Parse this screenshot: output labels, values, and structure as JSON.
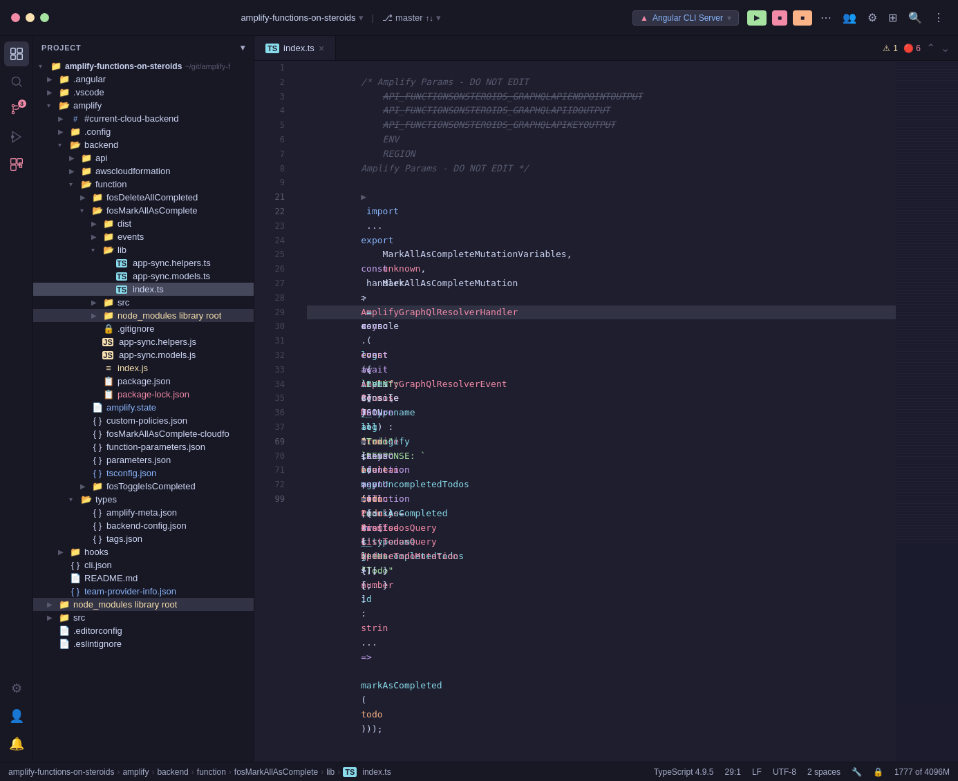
{
  "titlebar": {
    "project": "amplify-functions-on-steroids",
    "branch": "master",
    "server": "Angular CLI Server",
    "icons": [
      "ellipsis",
      "people",
      "wrench",
      "gamepad",
      "search",
      "more"
    ]
  },
  "sidebar": {
    "header": "Project",
    "tree": [
      {
        "label": "amplify-functions-on-steroids",
        "type": "root",
        "depth": 0,
        "open": true,
        "suffix": "~/git/amplify-f"
      },
      {
        "label": ".angular",
        "type": "folder-closed",
        "depth": 1,
        "color": "blue"
      },
      {
        "label": ".vscode",
        "type": "folder-closed",
        "depth": 1,
        "color": "blue"
      },
      {
        "label": "amplify",
        "type": "folder-open",
        "depth": 1,
        "color": "blue"
      },
      {
        "label": "#current-cloud-backend",
        "type": "folder-closed",
        "depth": 2,
        "color": "blue"
      },
      {
        "label": ".config",
        "type": "folder-closed",
        "depth": 2,
        "color": "blue"
      },
      {
        "label": "backend",
        "type": "folder-open",
        "depth": 2,
        "color": "blue"
      },
      {
        "label": "api",
        "type": "folder-closed",
        "depth": 3,
        "color": "blue"
      },
      {
        "label": "awscloudformation",
        "type": "folder-closed",
        "depth": 3,
        "color": "blue"
      },
      {
        "label": "function",
        "type": "folder-open",
        "depth": 3,
        "color": "blue"
      },
      {
        "label": "fosDeleteAllCompleted",
        "type": "folder-closed",
        "depth": 4,
        "color": "blue"
      },
      {
        "label": "fosMarkAllAsComplete",
        "type": "folder-open",
        "depth": 4,
        "color": "blue"
      },
      {
        "label": "dist",
        "type": "folder-closed",
        "depth": 5,
        "color": "blue"
      },
      {
        "label": "events",
        "type": "folder-closed",
        "depth": 5,
        "color": "blue"
      },
      {
        "label": "lib",
        "type": "folder-open",
        "depth": 5,
        "color": "blue"
      },
      {
        "label": "app-sync.helpers.ts",
        "type": "file-ts",
        "depth": 6
      },
      {
        "label": "app-sync.models.ts",
        "type": "file-ts",
        "depth": 6
      },
      {
        "label": "index.ts",
        "type": "file-ts",
        "depth": 6,
        "selected": true
      },
      {
        "label": "src",
        "type": "folder-closed",
        "depth": 5,
        "color": "blue"
      },
      {
        "label": "node_modules  library root",
        "type": "folder-closed",
        "depth": 5,
        "color": "yellow"
      },
      {
        "label": ".gitignore",
        "type": "file-git",
        "depth": 5
      },
      {
        "label": "app-sync.helpers.js",
        "type": "file-js",
        "depth": 5
      },
      {
        "label": "app-sync.models.js",
        "type": "file-js",
        "depth": 5
      },
      {
        "label": "index.js",
        "type": "file-js",
        "depth": 5
      },
      {
        "label": "package.json",
        "type": "file-json",
        "depth": 5
      },
      {
        "label": "package-lock.json",
        "type": "file-json-red",
        "depth": 5
      },
      {
        "label": "amplify.state",
        "type": "file-state",
        "depth": 4
      },
      {
        "label": "custom-policies.json",
        "type": "file-json",
        "depth": 4
      },
      {
        "label": "fosMarkAllAsComplete-cloudfo",
        "type": "file-json",
        "depth": 4
      },
      {
        "label": "function-parameters.json",
        "type": "file-json",
        "depth": 4
      },
      {
        "label": "parameters.json",
        "type": "file-json",
        "depth": 4
      },
      {
        "label": "tsconfig.json",
        "type": "file-json-blue",
        "depth": 4
      },
      {
        "label": "fosToggleIsCompleted",
        "type": "folder-closed",
        "depth": 4,
        "color": "blue"
      },
      {
        "label": "types",
        "type": "folder-open",
        "depth": 3,
        "color": "blue"
      },
      {
        "label": "amplify-meta.json",
        "type": "file-json",
        "depth": 4
      },
      {
        "label": "backend-config.json",
        "type": "file-json",
        "depth": 4
      },
      {
        "label": "tags.json",
        "type": "file-json",
        "depth": 4
      },
      {
        "label": "hooks",
        "type": "folder-closed",
        "depth": 2,
        "color": "blue"
      },
      {
        "label": "cli.json",
        "type": "file-json",
        "depth": 2
      },
      {
        "label": "README.md",
        "type": "file-md",
        "depth": 2
      },
      {
        "label": "team-provider-info.json",
        "type": "file-json-blue",
        "depth": 2
      },
      {
        "label": "node_modules  library root",
        "type": "folder-closed",
        "depth": 1,
        "color": "yellow"
      },
      {
        "label": "src",
        "type": "folder-closed",
        "depth": 1,
        "color": "blue"
      },
      {
        "label": ".editorconfig",
        "type": "file-plain",
        "depth": 1
      },
      {
        "label": ".eslintignore",
        "type": "file-plain",
        "depth": 1
      }
    ]
  },
  "editor": {
    "tab": "index.ts",
    "warnings": "1",
    "errors": "6",
    "lines": [
      {
        "num": 1,
        "content": "/* Amplify Params - DO NOT EDIT",
        "type": "comment"
      },
      {
        "num": 2,
        "content": "\tAPI_FUNCTIONSONSTEROIDS_GRAPHQLAPIENDPOINTOUTPUT",
        "type": "comment-strikethrough"
      },
      {
        "num": 3,
        "content": "\tAPI_FUNCTIONSONSTEROIDS_GRAPHQLAPIIDOUTPUT",
        "type": "comment-strikethrough"
      },
      {
        "num": 4,
        "content": "\tAPI_FUNCTIONSONSTEROIDS_GRAPHQLAPIKEYOUTPUT",
        "type": "comment-strikethrough"
      },
      {
        "num": 5,
        "content": "\tENV",
        "type": "comment"
      },
      {
        "num": 6,
        "content": "\tREGION",
        "type": "comment"
      },
      {
        "num": 7,
        "content": "Amplify Params - DO NOT EDIT */",
        "type": "comment"
      },
      {
        "num": 8,
        "content": "",
        "type": "empty"
      },
      {
        "num": 9,
        "content": "> import ...",
        "type": "fold"
      },
      {
        "num": 21,
        "content": "",
        "type": "empty"
      },
      {
        "num": 22,
        "content": "",
        "type": "empty"
      },
      {
        "num": 23,
        "content": "export const handler: AmplifyGraphQlResolverHandler<",
        "type": "code"
      },
      {
        "num": 24,
        "content": "\tMarkAllAsCompleteMutationVariables,",
        "type": "code"
      },
      {
        "num": 25,
        "content": "\tunknown,",
        "type": "code"
      },
      {
        "num": 26,
        "content": "\tMarkAllAsCompleteMutation",
        "type": "code"
      },
      {
        "num": 27,
        "content": "> = async (event : AmplifyGraphQlResolverEvent<Ma... > ) : Promise<boolean>  => {",
        "type": "code"
      },
      {
        "num": 28,
        "content": "\tconsole.log(`EVENT: ${JSON.stringify(event, null, 2)}`);",
        "type": "code"
      },
      {
        "num": 29,
        "content": "",
        "type": "empty"
      },
      {
        "num": 30,
        "content": "\tconst { items } : {__typename: \"Todo\", id: strin...  } = await getUncompletedTodos();",
        "type": "code"
      },
      {
        "num": 31,
        "content": "\tawait Promise.all(items.map(todo : {__typename: \"Todo\", id: strin...  => markAsCompleted(todo)));",
        "type": "code"
      },
      {
        "num": 32,
        "content": "",
        "type": "empty"
      },
      {
        "num": 33,
        "content": "\tconsole.log(`RESPONSE: `);",
        "type": "code"
      },
      {
        "num": 34,
        "content": "\treturn true;",
        "type": "code"
      },
      {
        "num": 35,
        "content": "}",
        "type": "code"
      },
      {
        "num": 36,
        "content": "",
        "type": "empty"
      },
      {
        "num": 37,
        "content": "> async function getUncompletedTodos(): Promise<ListTodosQuery> {...}",
        "type": "fold"
      },
      {
        "num": 69,
        "content": "",
        "type": "empty"
      },
      {
        "num": 70,
        "content": "\tasync function markAsCompleted(",
        "type": "code"
      },
      {
        "num": 71,
        "content": "\t\ttodo: ListTodosQuery['items'][number]",
        "type": "code"
      },
      {
        "num": 72,
        "content": "> ): Promise<UpdateTodoMutation> {...}",
        "type": "fold"
      },
      {
        "num": 99,
        "content": "",
        "type": "empty"
      }
    ]
  },
  "statusbar": {
    "breadcrumbs": [
      "amplify-functions-on-steroids",
      "amplify",
      "backend",
      "function",
      "fosMarkAllAsComplete",
      "lib",
      "index.ts"
    ],
    "typescript": "TypeScript 4.9.5",
    "position": "29:1",
    "lf": "LF",
    "encoding": "UTF-8",
    "indent": "2 spaces",
    "memory": "1777 of 4096M"
  }
}
